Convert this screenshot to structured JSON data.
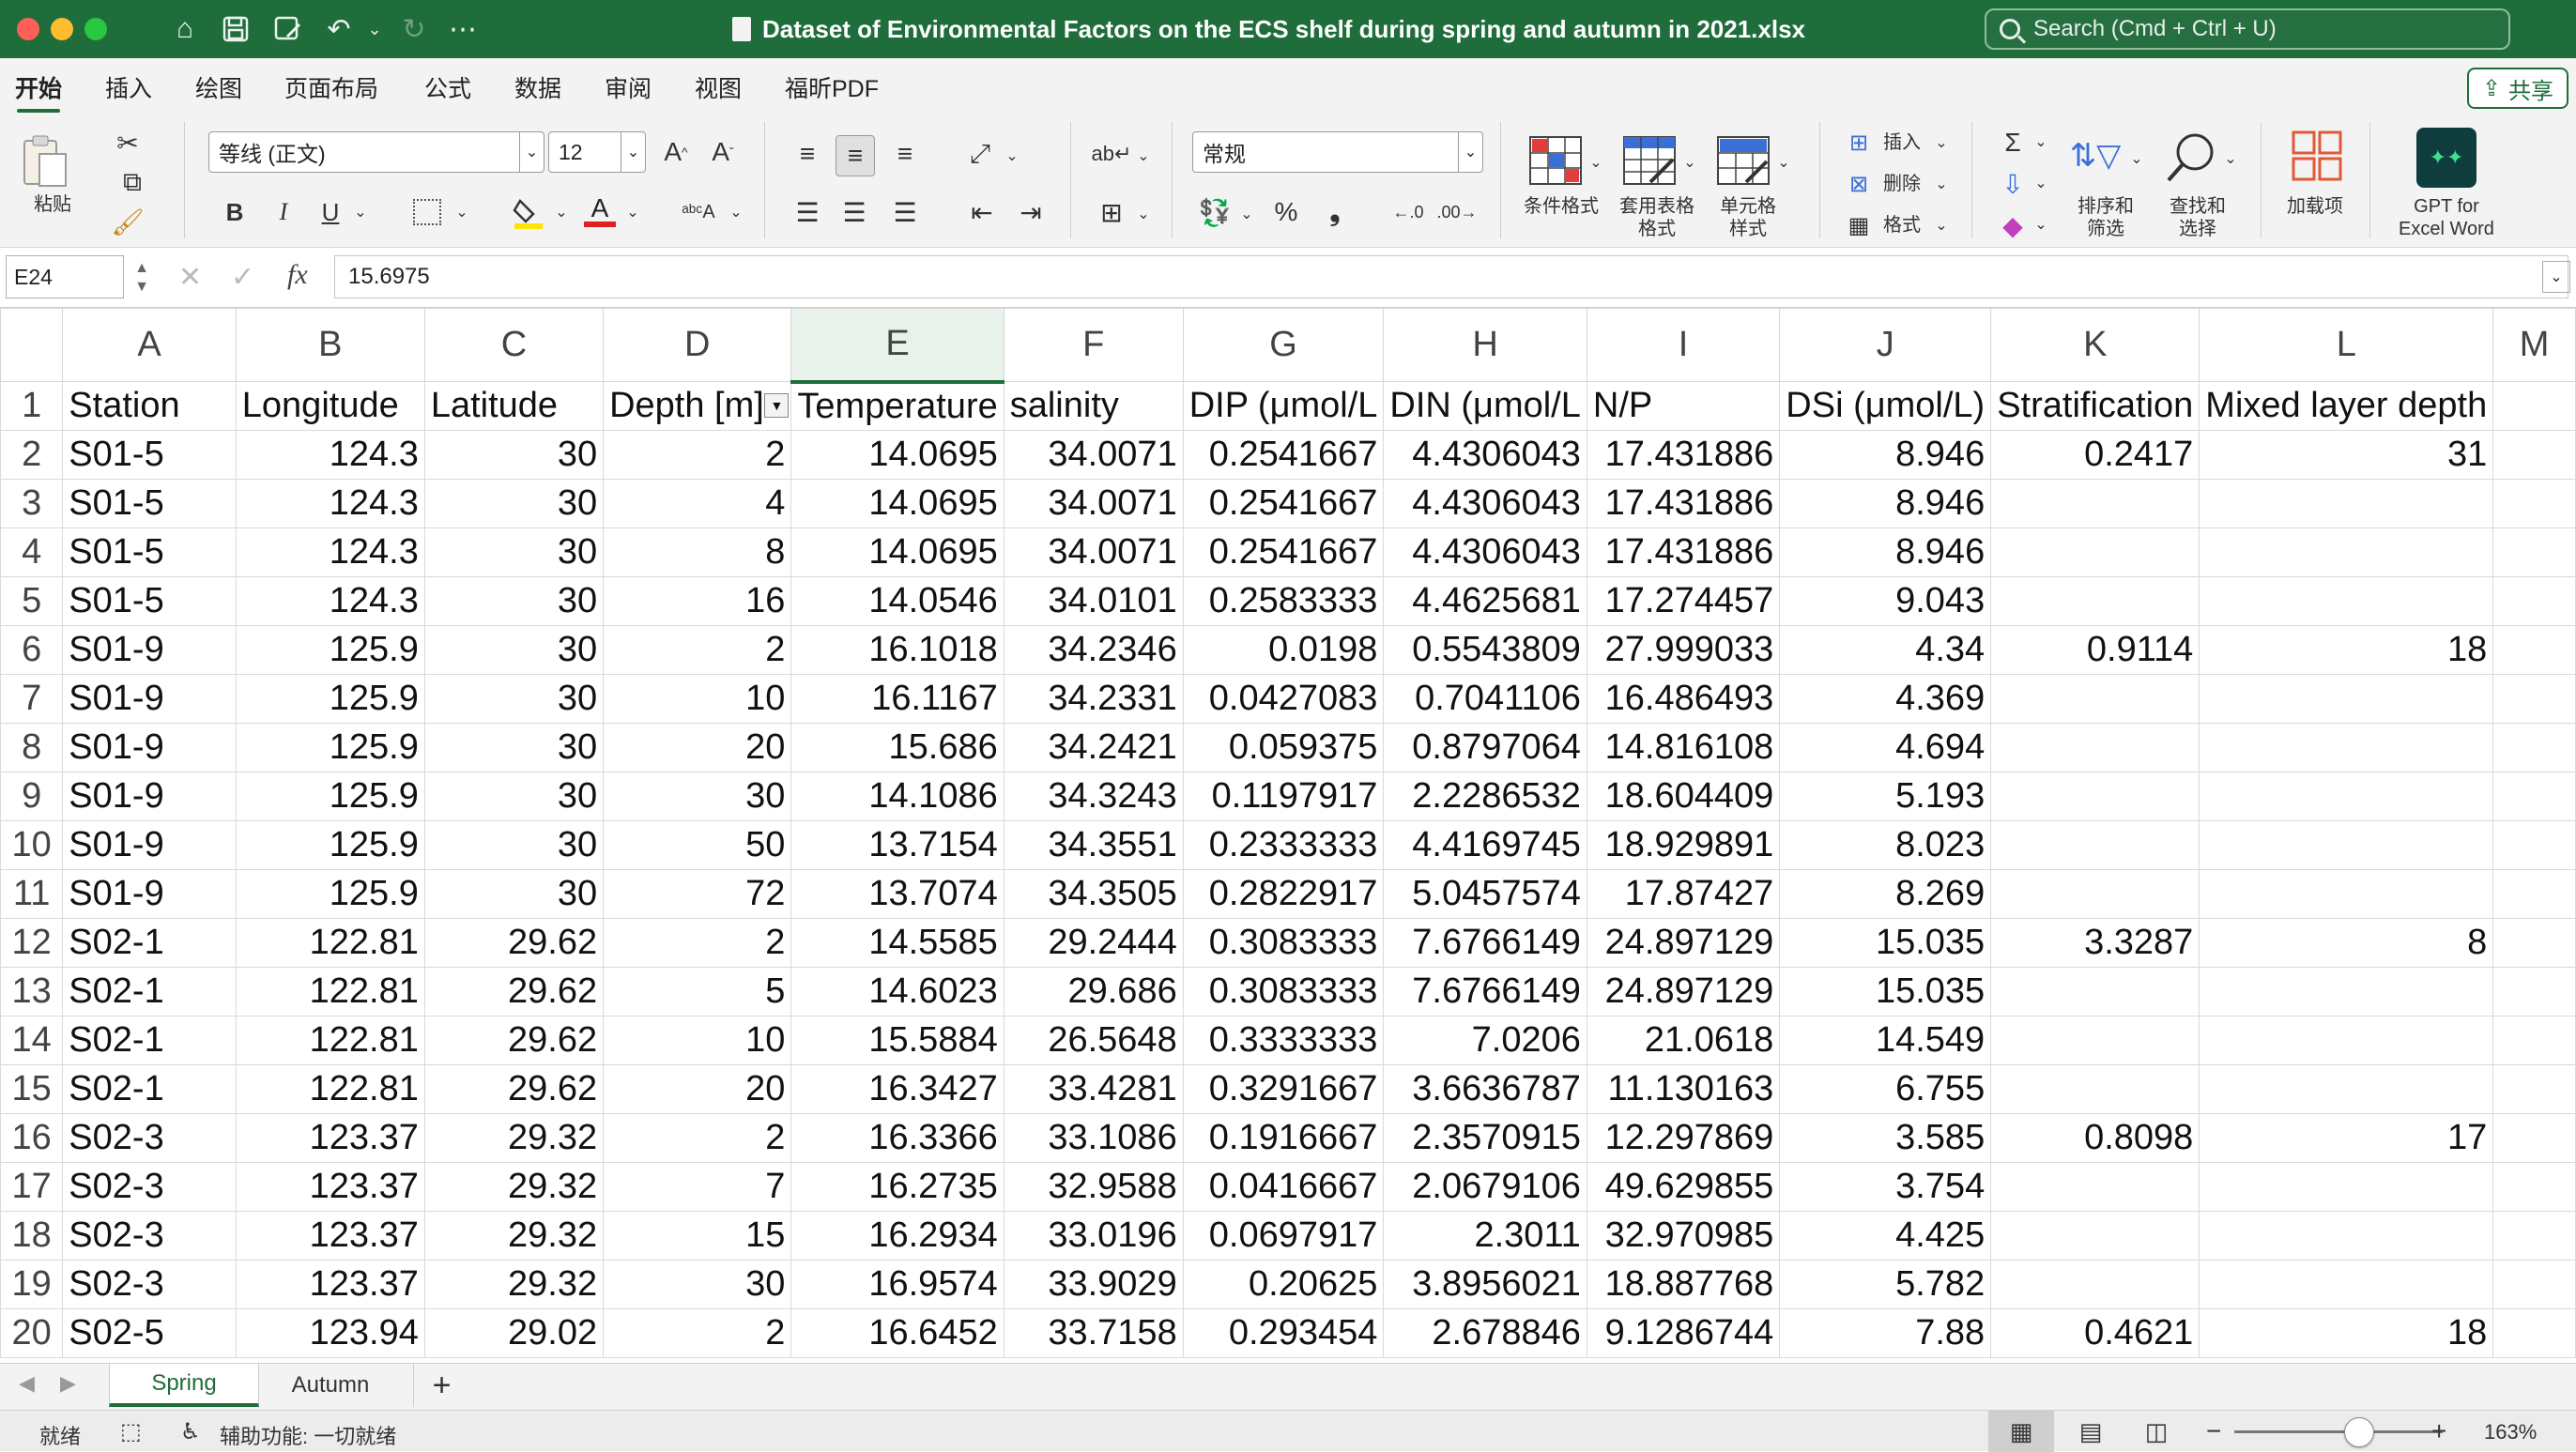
{
  "window": {
    "title": "Dataset of Environmental Factors on the ECS shelf during spring and autumn in 2021.xlsx",
    "search_placeholder": "Search (Cmd + Ctrl + U)"
  },
  "menu": {
    "tabs": [
      "开始",
      "插入",
      "绘图",
      "页面布局",
      "公式",
      "数据",
      "审阅",
      "视图",
      "福昕PDF"
    ],
    "active": "开始",
    "share_label": "共享"
  },
  "ribbon": {
    "paste_label": "粘贴",
    "font_name": "等线 (正文)",
    "font_size": "12",
    "number_format": "常规",
    "insert_label": "插入",
    "delete_label": "删除",
    "format_label": "格式",
    "conditional_format_label": "条件格式",
    "table_format_label": "套用表格\n格式",
    "cell_style_label": "单元格\n样式",
    "sort_filter_label": "排序和\n筛选",
    "find_select_label": "查找和\n选择",
    "addins_label": "加载项",
    "gpt_label": "GPT for\nExcel Word",
    "bold": "B",
    "italic": "I",
    "underline": "U"
  },
  "formula_bar": {
    "name_box": "E24",
    "formula": "15.6975",
    "fx": "fx"
  },
  "sheet": {
    "columns": [
      "A",
      "B",
      "C",
      "D",
      "E",
      "F",
      "G",
      "H",
      "I",
      "J",
      "K",
      "L",
      "M"
    ],
    "selected_column": "E",
    "header_row": [
      "Station",
      "Longitude",
      "Latitude",
      "Depth [m]",
      "Temperature",
      "salinity",
      "DIP (μmol/L",
      "DIN (μmol/L",
      "N/P",
      "DSi (μmol/L)",
      "Stratification",
      "Mixed layer depth",
      ""
    ],
    "rows": [
      [
        "S01-5",
        "124.3",
        "30",
        "2",
        "14.0695",
        "34.0071",
        "0.2541667",
        "4.4306043",
        "17.431886",
        "8.946",
        "0.2417",
        "31"
      ],
      [
        "S01-5",
        "124.3",
        "30",
        "4",
        "14.0695",
        "34.0071",
        "0.2541667",
        "4.4306043",
        "17.431886",
        "8.946",
        "",
        ""
      ],
      [
        "S01-5",
        "124.3",
        "30",
        "8",
        "14.0695",
        "34.0071",
        "0.2541667",
        "4.4306043",
        "17.431886",
        "8.946",
        "",
        ""
      ],
      [
        "S01-5",
        "124.3",
        "30",
        "16",
        "14.0546",
        "34.0101",
        "0.2583333",
        "4.4625681",
        "17.274457",
        "9.043",
        "",
        ""
      ],
      [
        "S01-9",
        "125.9",
        "30",
        "2",
        "16.1018",
        "34.2346",
        "0.0198",
        "0.5543809",
        "27.999033",
        "4.34",
        "0.9114",
        "18"
      ],
      [
        "S01-9",
        "125.9",
        "30",
        "10",
        "16.1167",
        "34.2331",
        "0.0427083",
        "0.7041106",
        "16.486493",
        "4.369",
        "",
        ""
      ],
      [
        "S01-9",
        "125.9",
        "30",
        "20",
        "15.686",
        "34.2421",
        "0.059375",
        "0.8797064",
        "14.816108",
        "4.694",
        "",
        ""
      ],
      [
        "S01-9",
        "125.9",
        "30",
        "30",
        "14.1086",
        "34.3243",
        "0.1197917",
        "2.2286532",
        "18.604409",
        "5.193",
        "",
        ""
      ],
      [
        "S01-9",
        "125.9",
        "30",
        "50",
        "13.7154",
        "34.3551",
        "0.2333333",
        "4.4169745",
        "18.929891",
        "8.023",
        "",
        ""
      ],
      [
        "S01-9",
        "125.9",
        "30",
        "72",
        "13.7074",
        "34.3505",
        "0.2822917",
        "5.0457574",
        "17.87427",
        "8.269",
        "",
        ""
      ],
      [
        "S02-1",
        "122.81",
        "29.62",
        "2",
        "14.5585",
        "29.2444",
        "0.3083333",
        "7.6766149",
        "24.897129",
        "15.035",
        "3.3287",
        "8"
      ],
      [
        "S02-1",
        "122.81",
        "29.62",
        "5",
        "14.6023",
        "29.686",
        "0.3083333",
        "7.6766149",
        "24.897129",
        "15.035",
        "",
        ""
      ],
      [
        "S02-1",
        "122.81",
        "29.62",
        "10",
        "15.5884",
        "26.5648",
        "0.3333333",
        "7.0206",
        "21.0618",
        "14.549",
        "",
        ""
      ],
      [
        "S02-1",
        "122.81",
        "29.62",
        "20",
        "16.3427",
        "33.4281",
        "0.3291667",
        "3.6636787",
        "11.130163",
        "6.755",
        "",
        ""
      ],
      [
        "S02-3",
        "123.37",
        "29.32",
        "2",
        "16.3366",
        "33.1086",
        "0.1916667",
        "2.3570915",
        "12.297869",
        "3.585",
        "0.8098",
        "17"
      ],
      [
        "S02-3",
        "123.37",
        "29.32",
        "7",
        "16.2735",
        "32.9588",
        "0.0416667",
        "2.0679106",
        "49.629855",
        "3.754",
        "",
        ""
      ],
      [
        "S02-3",
        "123.37",
        "29.32",
        "15",
        "16.2934",
        "33.0196",
        "0.0697917",
        "2.3011",
        "32.970985",
        "4.425",
        "",
        ""
      ],
      [
        "S02-3",
        "123.37",
        "29.32",
        "30",
        "16.9574",
        "33.9029",
        "0.20625",
        "3.8956021",
        "18.887768",
        "5.782",
        "",
        ""
      ],
      [
        "S02-5",
        "123.94",
        "29.02",
        "2",
        "16.6452",
        "33.7158",
        "0.293454",
        "2.678846",
        "9.1286744",
        "7.88",
        "0.4621",
        "18"
      ]
    ]
  },
  "sheet_tabs": [
    "Spring",
    "Autumn"
  ],
  "active_sheet": "Spring",
  "status": {
    "ready": "就绪",
    "accessibility": "辅助功能: 一切就绪",
    "zoom": "163%",
    "zoom_level": 0.6
  },
  "colors": {
    "brand": "#1e6d3b",
    "font_color_underline": "#e02020",
    "highlight_underline": "#ffe500"
  }
}
